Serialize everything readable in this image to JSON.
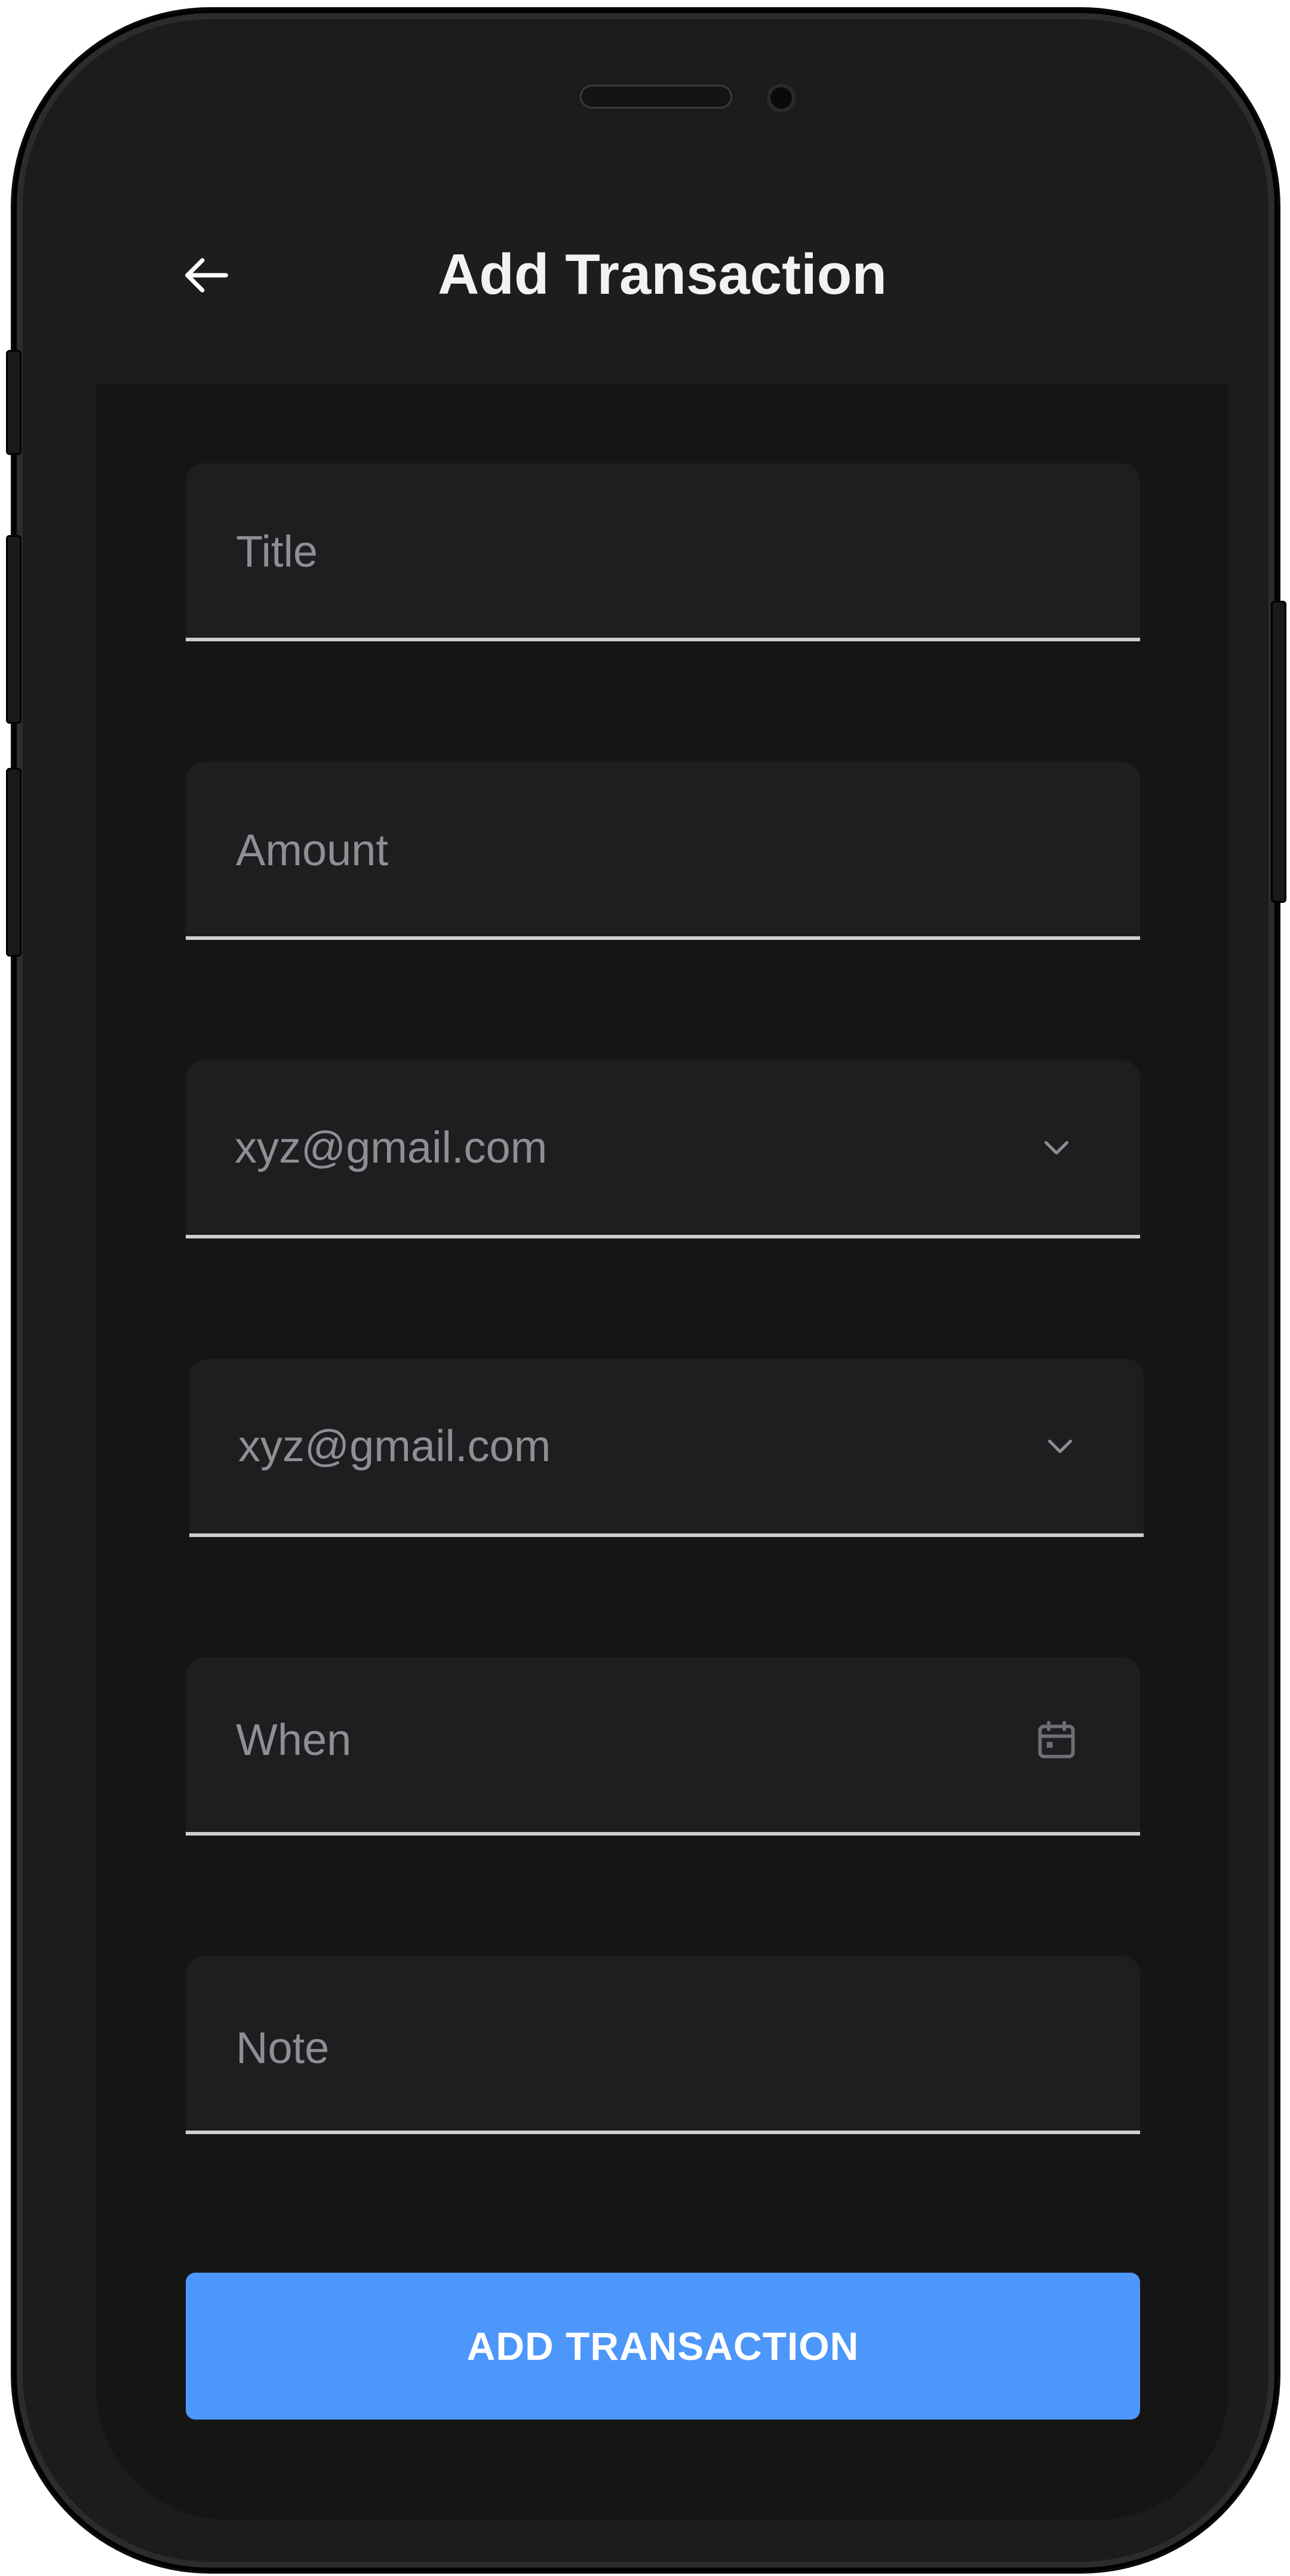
{
  "header": {
    "title": "Add Transaction",
    "back_icon": "arrow-left-icon"
  },
  "form": {
    "title_field": {
      "placeholder": "Title",
      "value": ""
    },
    "amount_field": {
      "placeholder": "Amount",
      "value": ""
    },
    "from_select": {
      "selected": "xyz@gmail.com",
      "icon": "chevron-down-icon"
    },
    "to_select": {
      "selected": "xyz@gmail.com",
      "icon": "chevron-down-icon"
    },
    "when_field": {
      "placeholder": "When",
      "value": "",
      "icon": "calendar-icon"
    },
    "note_field": {
      "placeholder": "Note",
      "value": ""
    }
  },
  "actions": {
    "submit_label": "ADD TRANSACTION"
  },
  "colors": {
    "accent": "#4d97fb",
    "background": "#151516",
    "appbar": "#1d1d1f",
    "field": "#1e1e21"
  }
}
